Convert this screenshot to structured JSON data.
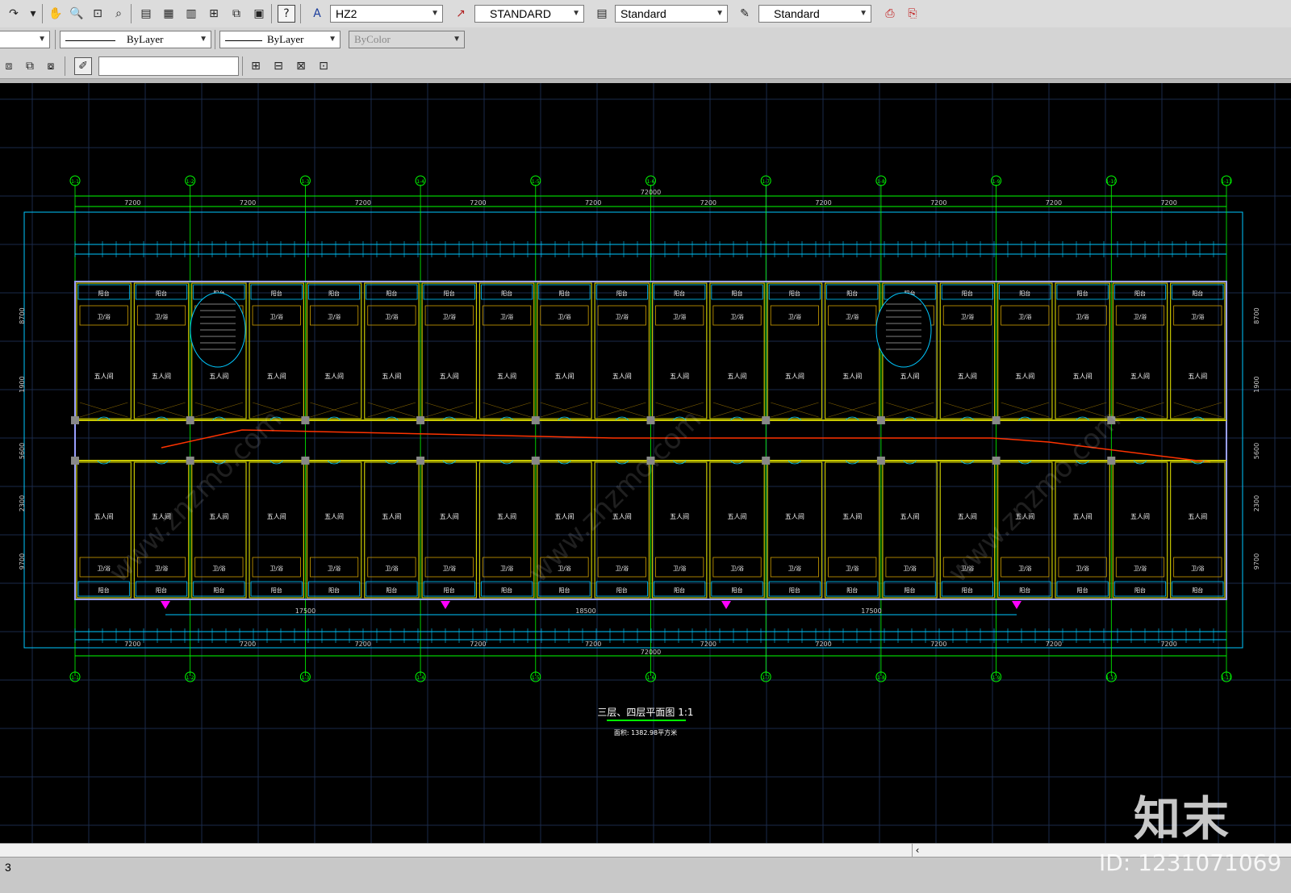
{
  "toolbar1": {
    "text_style": "HZ2",
    "dim_style": "STANDARD",
    "table_style": "Standard",
    "mleader_style": "Standard"
  },
  "toolbar2": {
    "linetype": "ByLayer",
    "lineweight": "ByLayer",
    "plotstyle": "ByColor"
  },
  "drawing": {
    "grid_labels": [
      "1-1",
      "1-2",
      "1-3",
      "1-4",
      "1-5",
      "1-6",
      "1-7",
      "1-8",
      "1-9",
      "1-10",
      "1-11"
    ],
    "bay_dims": [
      "7200",
      "7200",
      "7200",
      "7200",
      "7200",
      "7200",
      "7200",
      "7200",
      "7200",
      "7200"
    ],
    "overall_dim": "72000",
    "bottom_dims": [
      "17500",
      "18500",
      "17500"
    ],
    "right_dims": [
      "8700",
      "1900",
      "5600",
      "2300",
      "9700"
    ],
    "room_label": "五人间",
    "balcony_label": "阳台",
    "bath_label": "卫/浴",
    "title": "三层、四层平面图 1:1",
    "subtitle": "面积: 1382.98平方米",
    "colors": {
      "wall": "#c8c800",
      "grid": "#00c8ff",
      "axis": "#00ff00",
      "red": "#ff3300",
      "magenta": "#ff00ff"
    }
  },
  "status": {
    "left_text": "3"
  },
  "watermark": {
    "logo": "知末",
    "id": "ID: 1231071069"
  }
}
